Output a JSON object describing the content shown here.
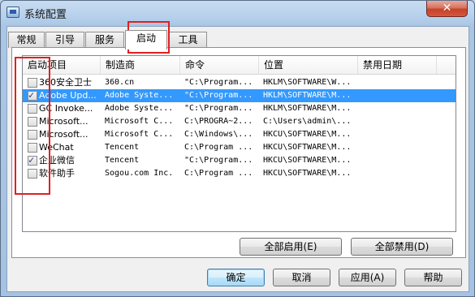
{
  "window": {
    "title": "系统配置",
    "close_label": "✕"
  },
  "tabs": [
    {
      "label": "常规"
    },
    {
      "label": "引导"
    },
    {
      "label": "服务"
    },
    {
      "label": "启动",
      "active": true
    },
    {
      "label": "工具"
    }
  ],
  "table": {
    "headers": [
      "启动项目",
      "制造商",
      "命令",
      "位置",
      "禁用日期"
    ],
    "rows": [
      {
        "checked": false,
        "selected": false,
        "name": "360安全卫士",
        "maker": "360.cn",
        "command": "\"C:\\Program...",
        "location": "HKLM\\SOFTWARE\\W...",
        "date": ""
      },
      {
        "checked": true,
        "selected": true,
        "name": "Adobe Upd...",
        "maker": "Adobe Syste...",
        "command": "\"C:\\Program...",
        "location": "HKLM\\SOFTWARE\\M...",
        "date": ""
      },
      {
        "checked": false,
        "selected": false,
        "name": "GC Invoke...",
        "maker": "Adobe Syste...",
        "command": "\"C:\\Program...",
        "location": "HKLM\\SOFTWARE\\M...",
        "date": ""
      },
      {
        "checked": false,
        "selected": false,
        "name": "Microsoft...",
        "maker": "Microsoft C...",
        "command": "C:\\PROGRA~2...",
        "location": "C:\\Users\\admin\\...",
        "date": ""
      },
      {
        "checked": false,
        "selected": false,
        "name": "Microsoft...",
        "maker": "Microsoft C...",
        "command": "C:\\Windows\\...",
        "location": "HKCU\\SOFTWARE\\M...",
        "date": ""
      },
      {
        "checked": false,
        "selected": false,
        "name": "WeChat",
        "maker": "Tencent",
        "command": "C:\\Program ...",
        "location": "HKCU\\SOFTWARE\\M...",
        "date": ""
      },
      {
        "checked": true,
        "selected": false,
        "name": "企业微信",
        "maker": "Tencent",
        "command": "\"C:\\Program...",
        "location": "HKCU\\SOFTWARE\\M...",
        "date": ""
      },
      {
        "checked": false,
        "selected": false,
        "name": "软件助手",
        "maker": "Sogou.com Inc.",
        "command": "C:\\Program ...",
        "location": "HKCU\\SOFTWARE\\M...",
        "date": ""
      }
    ]
  },
  "buttons": {
    "enable_all": "全部启用(E)",
    "disable_all": "全部禁用(D)",
    "ok": "确定",
    "cancel": "取消",
    "apply": "应用(A)",
    "help": "帮助"
  },
  "colors": {
    "selection": "#3399ff",
    "highlight_box": "#e02020",
    "frame": "#b4cfeb"
  }
}
